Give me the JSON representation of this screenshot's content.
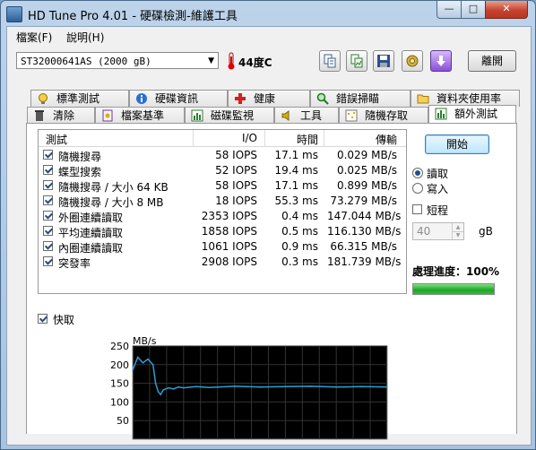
{
  "window": {
    "title": "HD Tune Pro 4.01 - 硬碟檢測-維護工具",
    "min_label": "—",
    "max_label": "□",
    "close_label": "✕"
  },
  "menu": [
    "檔案(F)",
    "說明(H)"
  ],
  "toolbar": {
    "drive": "ST32000641AS (2000 gB)",
    "temperature": "44度C",
    "exit_label": "離開",
    "buttons": [
      "copy-text-icon",
      "copy-image-icon",
      "save-icon",
      "options-icon",
      "download-icon"
    ]
  },
  "tabs": {
    "row1": [
      "標準測試",
      "硬碟資訊",
      "健康",
      "錯誤掃瞄",
      "資料夾使用率"
    ],
    "row2": [
      "清除",
      "檔案基準",
      "磁碟監視",
      "工具",
      "隨機存取",
      "額外測試"
    ],
    "active": "額外測試"
  },
  "results": {
    "headers": [
      "測試",
      "I/O",
      "時間",
      "傳輸"
    ],
    "rows": [
      {
        "checked": true,
        "name": "隨機搜尋",
        "io": "58 IOPS",
        "time": "17.1 ms",
        "transfer": "0.029 MB/s"
      },
      {
        "checked": true,
        "name": "蝶型搜索",
        "io": "52 IOPS",
        "time": "19.4 ms",
        "transfer": "0.025 MB/s"
      },
      {
        "checked": true,
        "name": "隨機搜尋 / 大小 64 KB",
        "io": "58 IOPS",
        "time": "17.1 ms",
        "transfer": "0.899 MB/s"
      },
      {
        "checked": true,
        "name": "隨機搜尋 / 大小 8 MB",
        "io": "18 IOPS",
        "time": "55.3 ms",
        "transfer": "73.279 MB/s"
      },
      {
        "checked": true,
        "name": "外圈連續讀取",
        "io": "2353 IOPS",
        "time": "0.4 ms",
        "transfer": "147.044 MB/s"
      },
      {
        "checked": true,
        "name": "平均連續讀取",
        "io": "1858 IOPS",
        "time": "0.5 ms",
        "transfer": "116.130 MB/s"
      },
      {
        "checked": true,
        "name": "內圈連續讀取",
        "io": "1061 IOPS",
        "time": "0.9 ms",
        "transfer": "66.315 MB/s"
      },
      {
        "checked": true,
        "name": "突發率",
        "io": "2908 IOPS",
        "time": "0.3 ms",
        "transfer": "181.739 MB/s"
      }
    ]
  },
  "controls": {
    "start_label": "開始",
    "read_label": "讀取",
    "write_label": "寫入",
    "mode": "read",
    "short_label": "短程",
    "short_checked": false,
    "short_value": "40",
    "short_unit": "gB",
    "progress_label": "處理進度：100%",
    "progress_fraction": 1.0,
    "quick_label": "快取",
    "quick_checked": true
  },
  "chart_data": {
    "type": "line",
    "ylabel": "MB/s",
    "yticks": [
      "250",
      "200",
      "150",
      "100",
      "50"
    ],
    "ylim": [
      0,
      250
    ],
    "grid": true,
    "series": [
      {
        "color": "#2a9fd6",
        "x": [
          0,
          2,
          4,
          6,
          8,
          9,
          10,
          11,
          12,
          14,
          16,
          18,
          20,
          25,
          30,
          40,
          50,
          60,
          70,
          80,
          90,
          100
        ],
        "values": [
          185,
          220,
          205,
          215,
          200,
          150,
          128,
          120,
          132,
          138,
          135,
          140,
          138,
          141,
          139,
          142,
          140,
          141,
          142,
          140,
          141,
          140
        ]
      }
    ]
  }
}
